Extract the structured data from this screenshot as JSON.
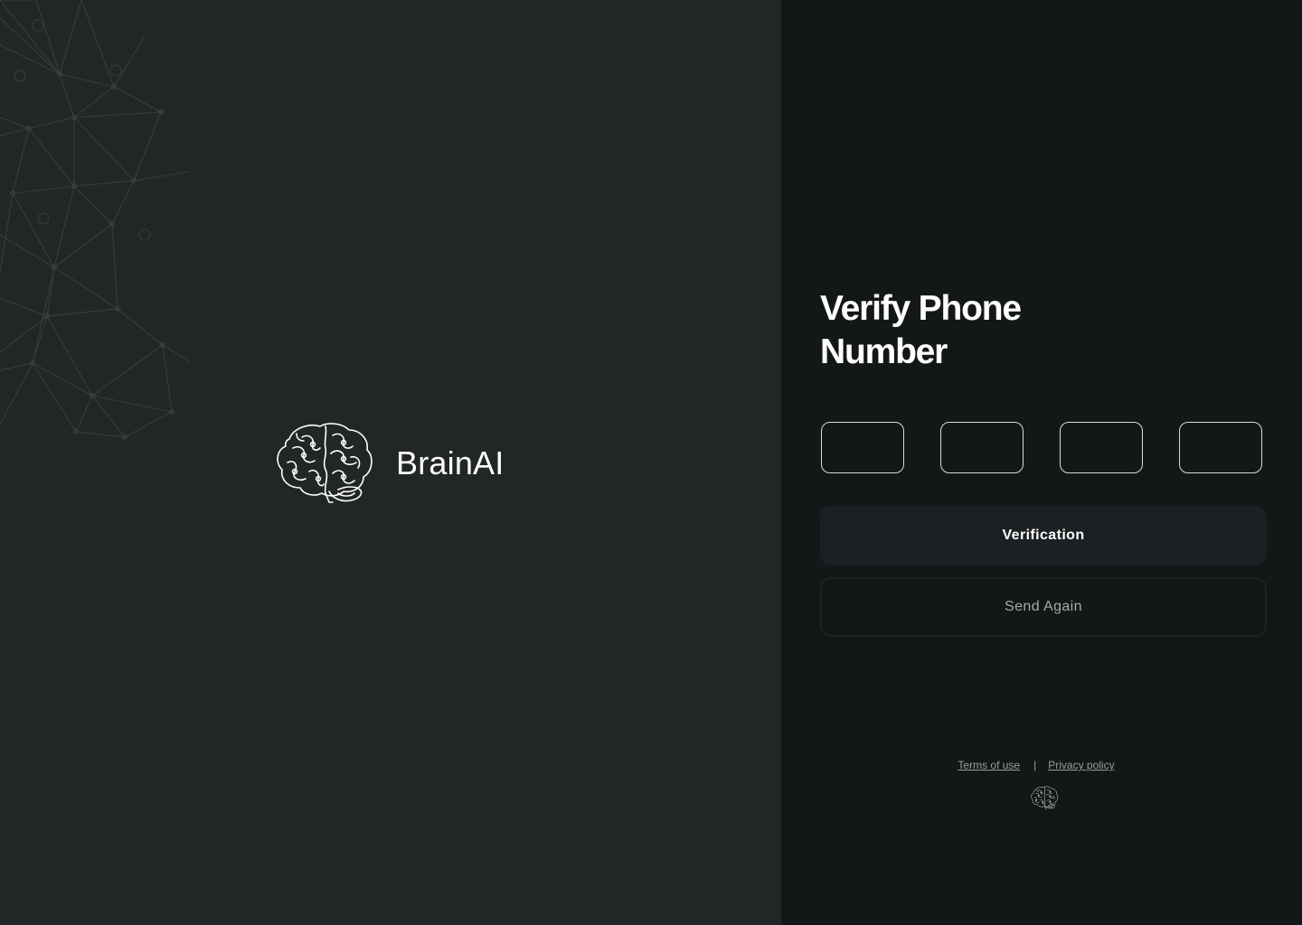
{
  "brand": {
    "name": "BrainAI",
    "logo_icon": "brain-icon"
  },
  "verify": {
    "title": "Verify Phone Number",
    "code_fields": [
      {
        "value": "",
        "placeholder": ""
      },
      {
        "value": "",
        "placeholder": ""
      },
      {
        "value": "",
        "placeholder": ""
      },
      {
        "value": "",
        "placeholder": ""
      }
    ],
    "verify_button_label": "Verification",
    "send_again_label": "Send Again"
  },
  "footer": {
    "terms_label": "Terms of use",
    "separator": "|",
    "privacy_label": "Privacy policy",
    "logo_icon": "brain-icon"
  },
  "colors": {
    "left_background": "#232627",
    "right_background": "#141718",
    "primary_text": "#fefefe",
    "muted_text": "#9a9c9d",
    "verify_button_bg": "#1d2022",
    "code_box_border": "#d9d9d9"
  }
}
